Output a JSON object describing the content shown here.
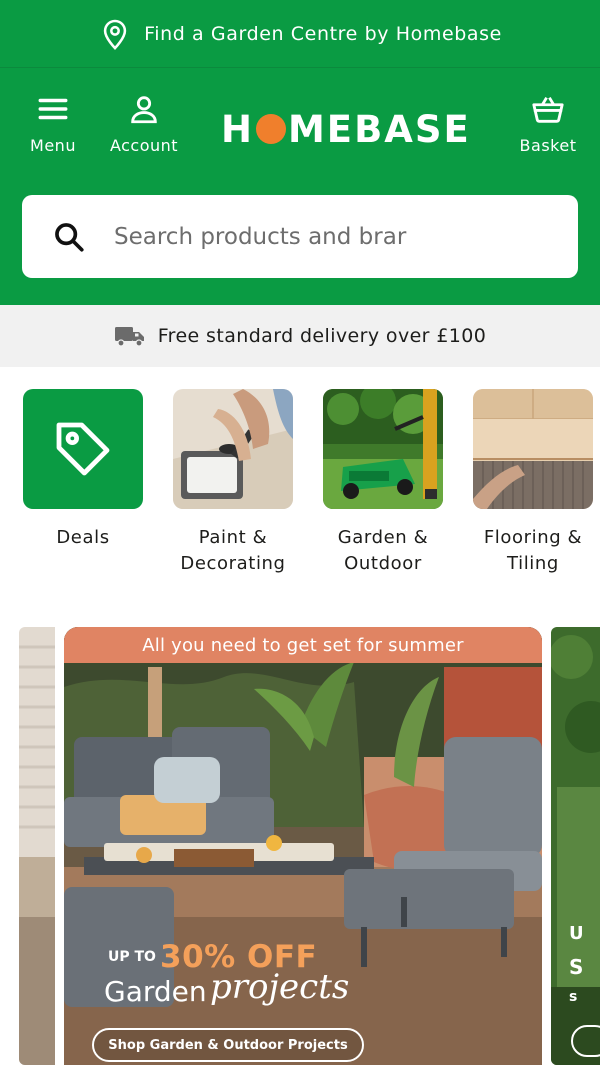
{
  "topbar": {
    "text": "Find a Garden Centre by Homebase",
    "icon": "location-pin-icon"
  },
  "header": {
    "menu_label": "Menu",
    "account_label": "Account",
    "basket_label": "Basket",
    "logo": {
      "text_h": "H",
      "text_rest": "MEBASE"
    }
  },
  "search": {
    "placeholder": "Search products and brar"
  },
  "delivery": {
    "text": "Free standard delivery over £100",
    "icon": "delivery-truck-icon"
  },
  "categories": [
    {
      "label": "Deals"
    },
    {
      "label": "Paint &\nDecorating"
    },
    {
      "label": "Garden &\nOutdoor"
    },
    {
      "label": "Flooring &\nTiling"
    }
  ],
  "promo": {
    "strip": "All you need to get set for summer",
    "upto": "UP TO",
    "percent": "30% OFF",
    "line1": "Garden",
    "line2": "projects",
    "cta": "Shop Garden & Outdoor Projects"
  },
  "peek_right": {
    "t1": "U",
    "t2": "S",
    "t3": "s"
  },
  "colors": {
    "brand_green": "#0a9b43",
    "accent_orange": "#f07f2c",
    "strip_peach": "#e08463"
  }
}
